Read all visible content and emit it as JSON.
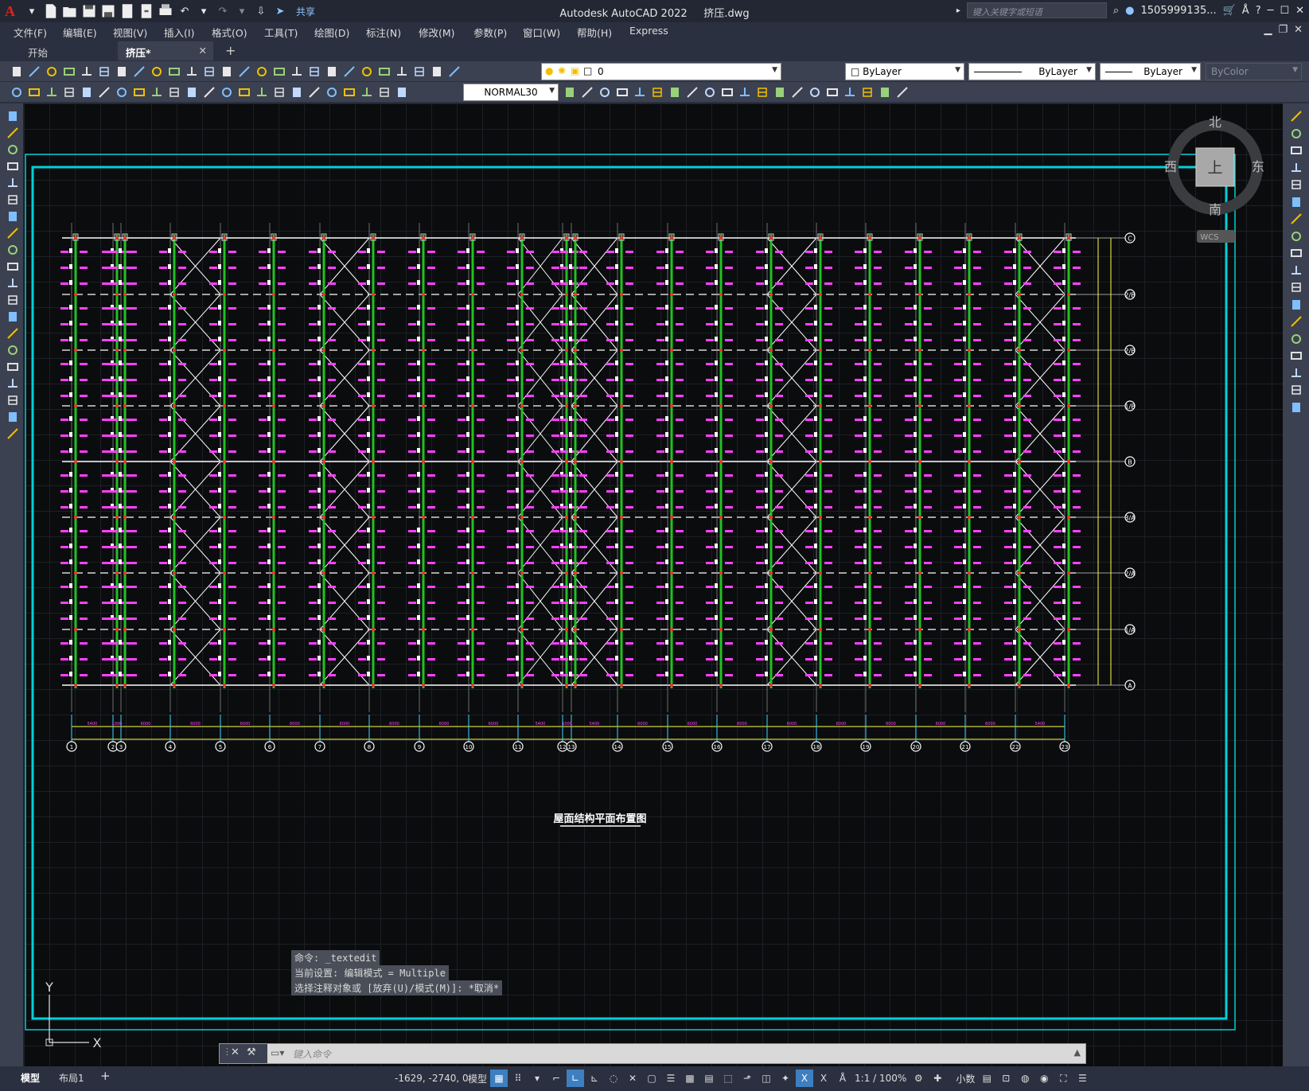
{
  "titlebar": {
    "app_title": "Autodesk AutoCAD 2022",
    "file_name": "挤压.dwg",
    "share_label": "共享",
    "search_placeholder": "键入关键字或短语",
    "user_name": "1505999135..."
  },
  "menu": [
    "文件(F)",
    "编辑(E)",
    "视图(V)",
    "插入(I)",
    "格式(O)",
    "工具(T)",
    "绘图(D)",
    "标注(N)",
    "修改(M)",
    "参数(P)",
    "窗口(W)",
    "帮助(H)",
    "Express"
  ],
  "tabs": {
    "start": "开始",
    "doc": "挤压*"
  },
  "toolbar": {
    "layer_name": "0",
    "color": "ByLayer",
    "linetype": "ByLayer",
    "lineweight": "ByLayer",
    "plotstyle": "ByColor",
    "dimstyle": "NORMAL30"
  },
  "viewcube": {
    "north": "北",
    "south": "南",
    "east": "东",
    "west": "西",
    "top": "上",
    "wcs": "WCS"
  },
  "drawing": {
    "title": "屋面结构平面布置图",
    "col_labels": [
      "1",
      "2",
      "3",
      "4",
      "5",
      "6",
      "7",
      "8",
      "9",
      "10",
      "11",
      "12",
      "13",
      "14",
      "15",
      "16",
      "17",
      "18",
      "19",
      "20",
      "21",
      "22",
      "23"
    ],
    "row_labels": [
      "C",
      "2/B",
      "2/B",
      "1/B",
      "B",
      "3/A",
      "2/A",
      "1/A",
      "A"
    ],
    "dim_values": [
      "5400",
      "1000",
      "6000",
      "6000",
      "6000",
      "6000",
      "6000",
      "6000",
      "6000",
      "6000",
      "5400",
      "1000",
      "5400",
      "6000",
      "6000",
      "6000",
      "6000",
      "6000",
      "6000",
      "6000",
      "6000",
      "5400"
    ]
  },
  "ucs": {
    "x": "X",
    "y": "Y"
  },
  "command": {
    "history": [
      "命令: _textedit",
      "当前设置: 编辑模式 = Multiple",
      "选择注释对象或 [放弃(U)/模式(M)]: *取消*"
    ],
    "placeholder": "键入命令"
  },
  "status": {
    "model_tab": "模型",
    "layout_tab": "布局1",
    "coords": "-1629, -2740, 0",
    "space": "模型",
    "scale": "1:1 / 100%",
    "units": "小数"
  },
  "colors": {
    "canvas": "#0b0c0e",
    "frame": "#00d0d8",
    "beam": "#ffffff",
    "column": "#22c022",
    "label": "#ff40ff",
    "dim": "#ffff40"
  }
}
